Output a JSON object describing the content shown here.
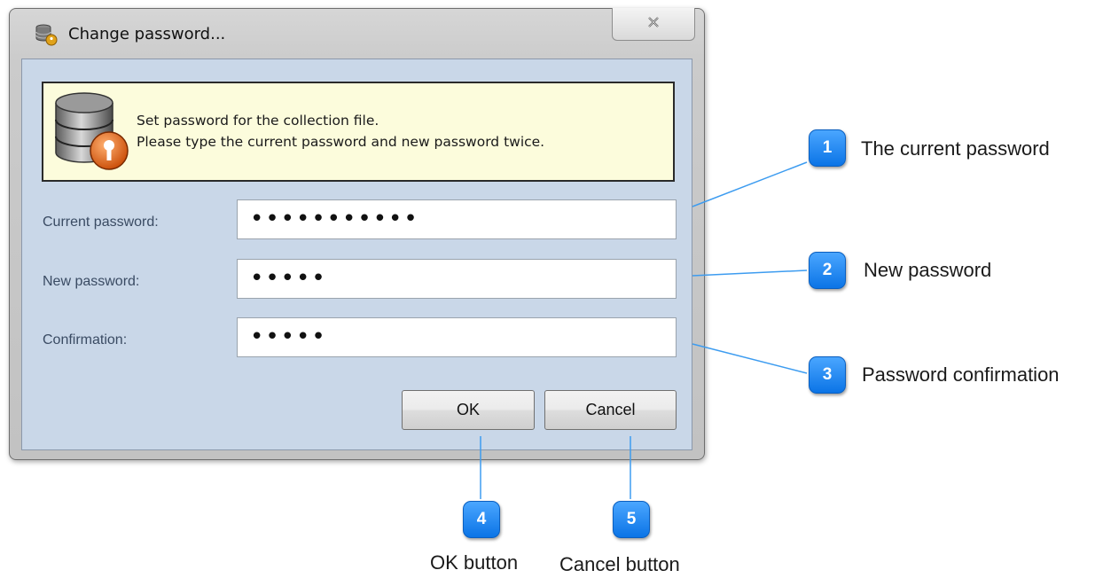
{
  "dialog": {
    "title": "Change password...",
    "info_line1": "Set password for the collection file.",
    "info_line2": "Please type the current password and new password twice.",
    "fields": [
      {
        "label": "Current password:",
        "value": "•••••••••••"
      },
      {
        "label": "New password:",
        "value": "•••••"
      },
      {
        "label": "Confirmation:",
        "value": "•••••"
      }
    ],
    "ok_label": "OK",
    "cancel_label": "Cancel"
  },
  "callouts": [
    {
      "number": "1",
      "label": "The current password"
    },
    {
      "number": "2",
      "label": "New password"
    },
    {
      "number": "3",
      "label": "Password confirmation"
    },
    {
      "number": "4",
      "label": "OK button"
    },
    {
      "number": "5",
      "label": "Cancel button"
    }
  ],
  "colors": {
    "callout_badge": "#1a86f5",
    "callout_line": "#3d9cf0",
    "client_area": "#c9d7e8",
    "info_box": "#fcfcdc"
  }
}
